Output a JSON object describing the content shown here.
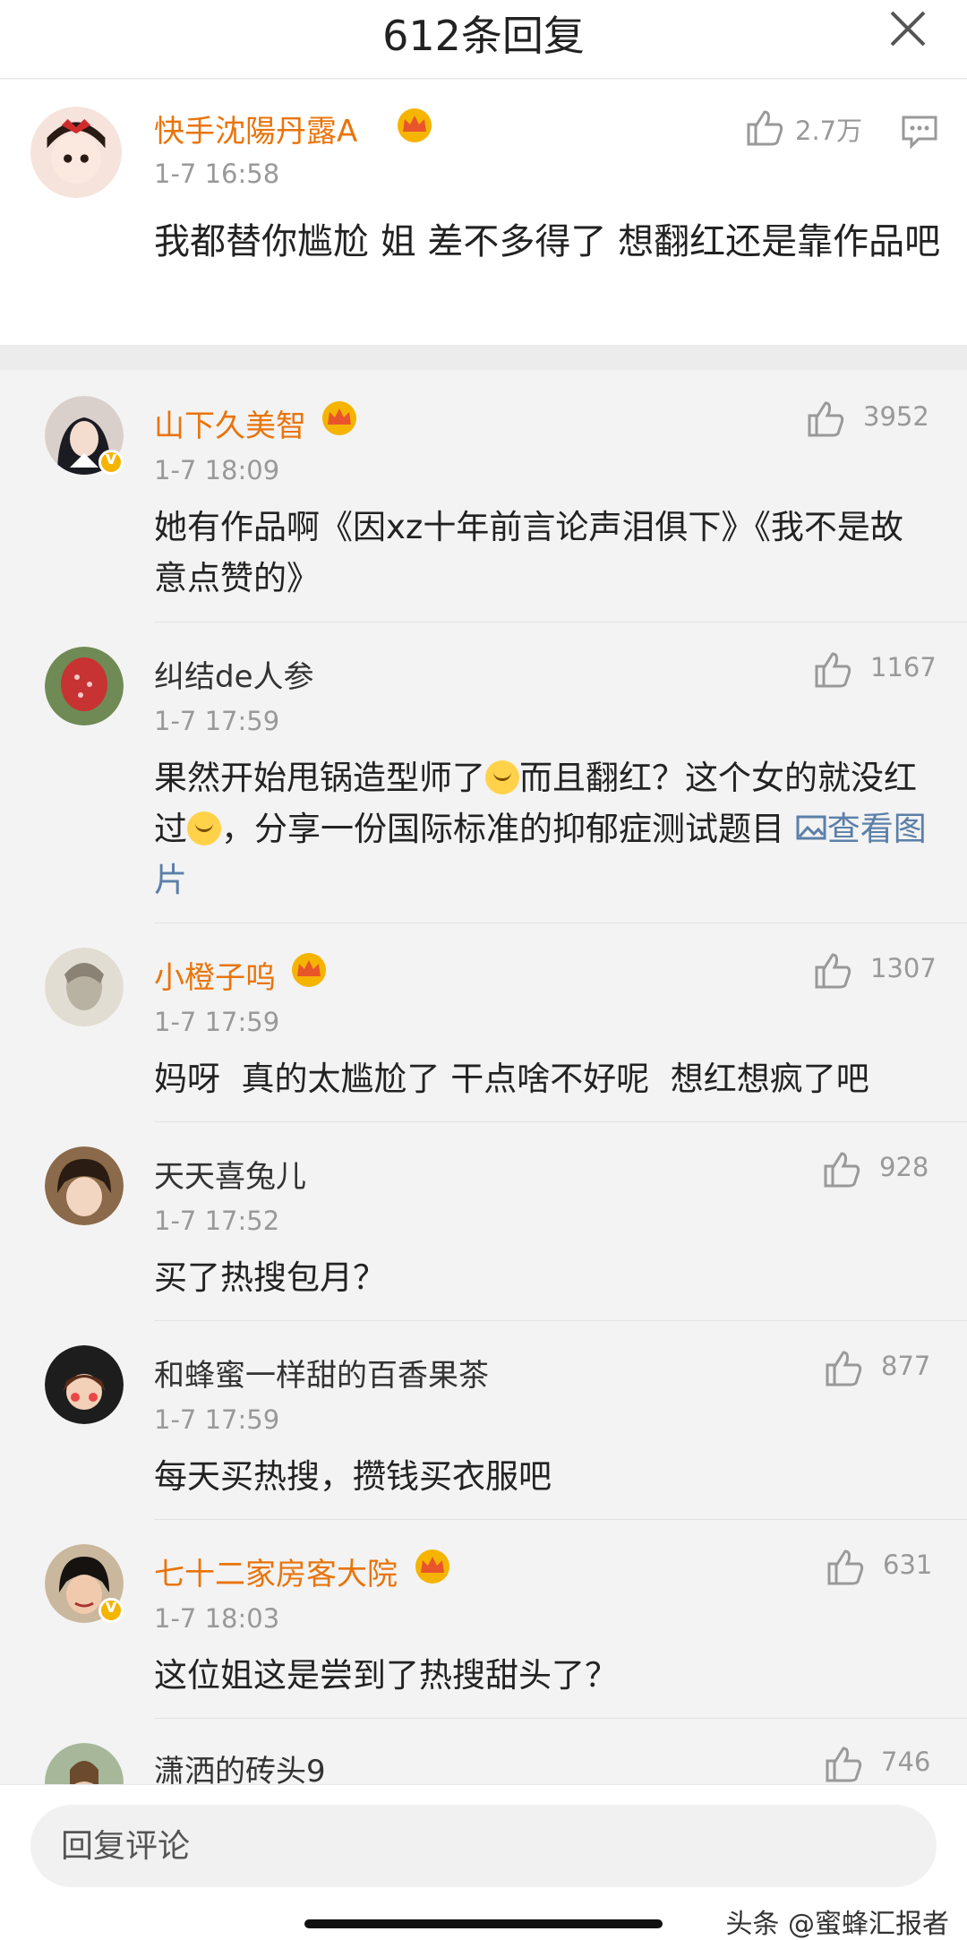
{
  "header": {
    "title": "612条回复"
  },
  "main_comment": {
    "user": "快手沈陽丹露A",
    "time": "1-7 16:58",
    "likes": "2.7万",
    "text": "我都替你尴尬 姐 差不多得了 想翻红还是靠作品吧"
  },
  "replies": [
    {
      "user": "山下久美智",
      "time": "1-7 18:09",
      "likes": "3952",
      "text": "她有作品啊《因xz十年前言论声泪俱下》《我不是故意点赞的》"
    },
    {
      "user": "纠结de人参",
      "time": "1-7 17:59",
      "likes": "1167",
      "text_1": "果然开始甩锅造型师了",
      "text_2": "而且翻红？这个女的就没红过",
      "text_3": "，分享一份国际标准的抑郁症测试题目 ",
      "link": "查看图片"
    },
    {
      "user": "小橙子呜",
      "time": "1-7 17:59",
      "likes": "1307",
      "text": "妈呀  真的太尴尬了 干点啥不好呢  想红想疯了吧"
    },
    {
      "user": "天天喜兔儿",
      "time": "1-7 17:52",
      "likes": "928",
      "text": "买了热搜包月？"
    },
    {
      "user": "和蜂蜜一样甜的百香果茶",
      "time": "1-7 17:59",
      "likes": "877",
      "text": "每天买热搜，攒钱买衣服吧"
    },
    {
      "user": "七十二家房客大院",
      "time": "1-7 18:03",
      "likes": "631",
      "text": "这位姐这是尝到了热搜甜头了？"
    },
    {
      "user": "潇洒的砖头9",
      "likes": "746"
    }
  ],
  "reply_bar": {
    "placeholder": "回复评论"
  },
  "watermark": "头条 @蜜蜂汇报者",
  "colors": {
    "vip_name": "#e9740b",
    "link": "#5b7fa8",
    "badge": "#f5b400"
  }
}
